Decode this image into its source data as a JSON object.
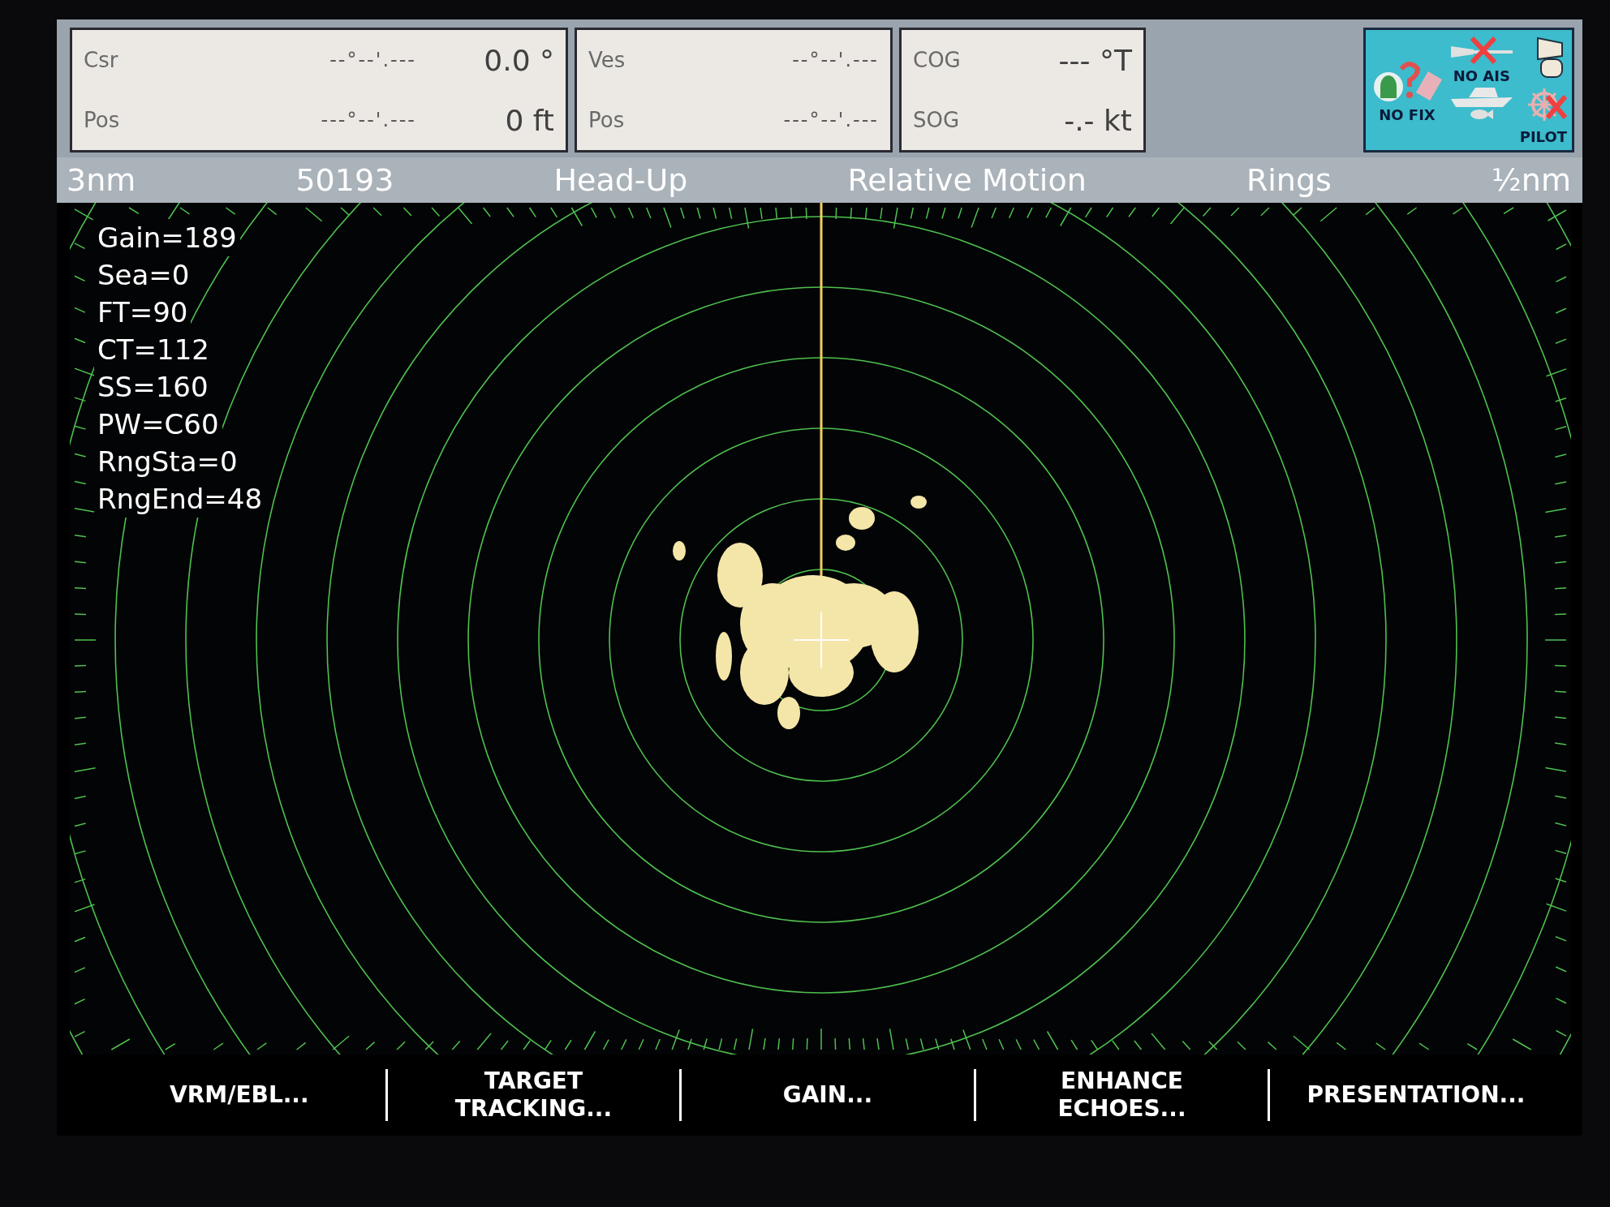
{
  "readout_panels": [
    {
      "rows": [
        {
          "label": "Csr",
          "position": "--°--'.---",
          "value": "0.0 °"
        },
        {
          "label": "Pos",
          "position": "---°--'.---",
          "value": "0 ft"
        }
      ]
    },
    {
      "rows": [
        {
          "label": "Ves",
          "position": "--°--'.---"
        },
        {
          "label": "Pos",
          "position": "---°--'.---"
        }
      ]
    },
    {
      "rows": [
        {
          "label": "COG",
          "value": "--- °T"
        },
        {
          "label": "SOG",
          "value": "-.- kt"
        }
      ]
    }
  ],
  "status_icons": {
    "gps": "NO FIX",
    "ais": "NO AIS",
    "autopilot": "PILOT"
  },
  "status_bar": [
    "3nm",
    "50193",
    "Head-Up",
    "Relative Motion",
    "Rings",
    "½nm"
  ],
  "radar_settings": [
    "Gain=189",
    "Sea=0",
    "FT=90",
    "CT=112",
    "SS=160",
    "PW=C60",
    "RngSta=0",
    "RngEnd=48"
  ],
  "softkeys": [
    "VRM/EBL...",
    "TARGET TRACKING...",
    "GAIN...",
    "ENHANCE ECHOES...",
    "PRESENTATION..."
  ]
}
